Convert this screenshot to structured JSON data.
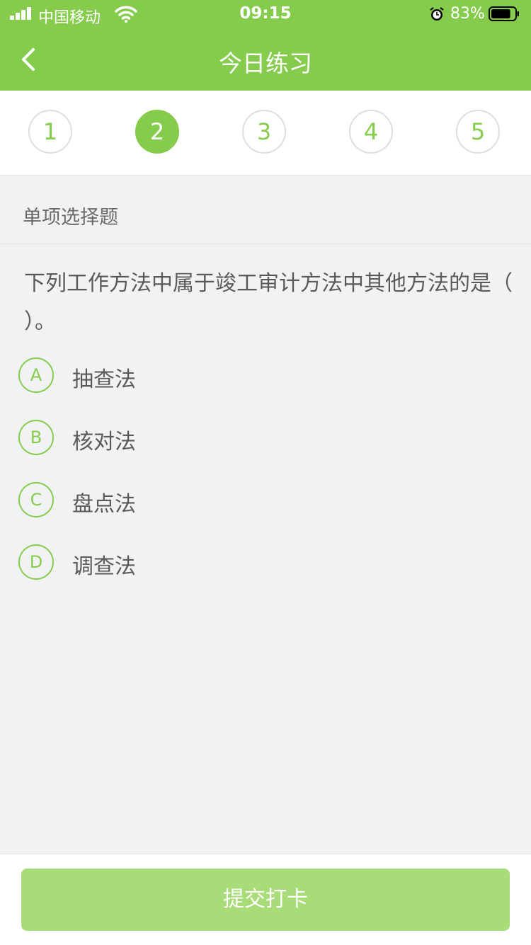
{
  "status_bar": {
    "carrier": "中国移动",
    "time": "09:15",
    "battery_percent": "83%",
    "battery_level": 0.83,
    "icons": [
      "signal-icon",
      "wifi-icon",
      "alarm-icon",
      "battery-icon"
    ]
  },
  "nav": {
    "back_icon": "chevron-left-icon",
    "title": "今日练习"
  },
  "steps": {
    "items": [
      "1",
      "2",
      "3",
      "4",
      "5"
    ],
    "active_index": 1
  },
  "question": {
    "type": "单项选择题",
    "text": "下列工作方法中属于竣工审计方法中其他方法的是（ ）。",
    "options": [
      {
        "letter": "A",
        "text": "抽查法"
      },
      {
        "letter": "B",
        "text": "核对法"
      },
      {
        "letter": "C",
        "text": "盘点法"
      },
      {
        "letter": "D",
        "text": "调查法"
      }
    ]
  },
  "footer": {
    "submit_label": "提交打卡"
  },
  "colors": {
    "brand": "#86cc4c",
    "button_disabled": "#a8dc79",
    "background": "#f1f2f4"
  }
}
